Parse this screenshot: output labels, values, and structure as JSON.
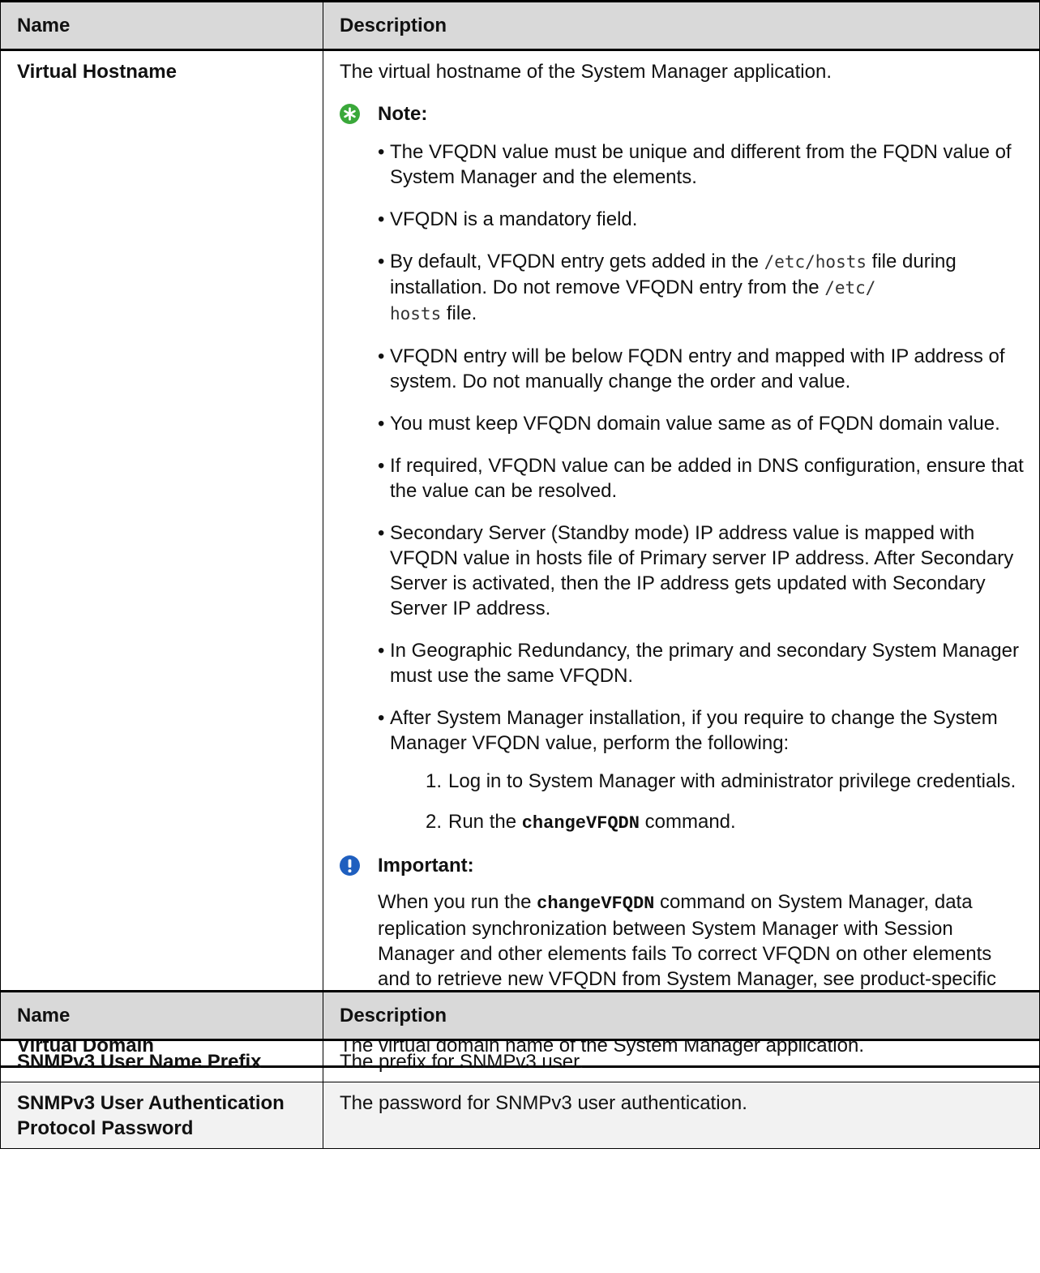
{
  "table1": {
    "headers": [
      "Name",
      "Description"
    ],
    "row1": {
      "name": "Virtual Hostname",
      "intro": "The virtual hostname of the System Manager application.",
      "note_label": "Note:",
      "bullets": [
        "The VFQDN value must be unique and different from the FQDN value of System Manager and the elements.",
        "VFQDN is a mandatory field.",
        "By default, VFQDN entry gets added in the",
        "VFQDN entry will be below FQDN entry and mapped with IP address of system. Do not manually change the order and value.",
        "You must keep VFQDN domain value same as of FQDN domain value.",
        "If required, VFQDN value can be added in DNS configuration, ensure that the value can be resolved.",
        "Secondary Server (Standby mode) IP address value is mapped with VFQDN value in hosts file of Primary server IP address. After Secondary Server is activated, then the IP address gets updated with Secondary Server IP address.",
        "In Geographic Redundancy, the primary and secondary System Manager must use the same VFQDN.",
        "After System Manager installation, if you require to change the System Manager VFQDN value, perform the following:"
      ],
      "bullet3_parts": {
        "before": "By default, VFQDN entry gets added in the ",
        "code1": "/etc/hosts",
        "middle": " file during installation. Do not remove VFQDN entry from the ",
        "code2": "/etc/\nhosts",
        "after": " file."
      },
      "steps": [
        {
          "num": "1.",
          "text": "Log in to System Manager with administrator privilege credentials."
        },
        {
          "num": "2.",
          "before": "Run the ",
          "code": "changeVFQDN",
          "after": " command."
        }
      ],
      "important_label": "Important:",
      "important_before": "When you run the ",
      "important_code": "changeVFQDN",
      "important_after": " command on System Manager, data replication synchronization between System Manager with Session Manager and other elements fails To correct VFQDN on other elements and to retrieve new VFQDN from System Manager, see product-specific Administering document."
    },
    "row2": {
      "name": "Virtual Domain",
      "description": "The virtual domain name of the System Manager application."
    }
  },
  "table2": {
    "headers": [
      "Name",
      "Description"
    ],
    "rows": [
      {
        "name": "SNMPv3 User Name Prefix",
        "description": "The prefix for SNMPv3 user."
      },
      {
        "name": "SNMPv3 User Authentication Protocol Password",
        "description": "The password for SNMPv3 user authentication."
      }
    ]
  },
  "colors": {
    "note_icon": "#3aa83a",
    "important_icon": "#1f5fbf",
    "header_bg": "#d9d9d9",
    "gray_row_bg": "#f2f2f2"
  },
  "icons": {
    "note": "note-asterisk-icon",
    "important": "important-exclamation-icon"
  }
}
